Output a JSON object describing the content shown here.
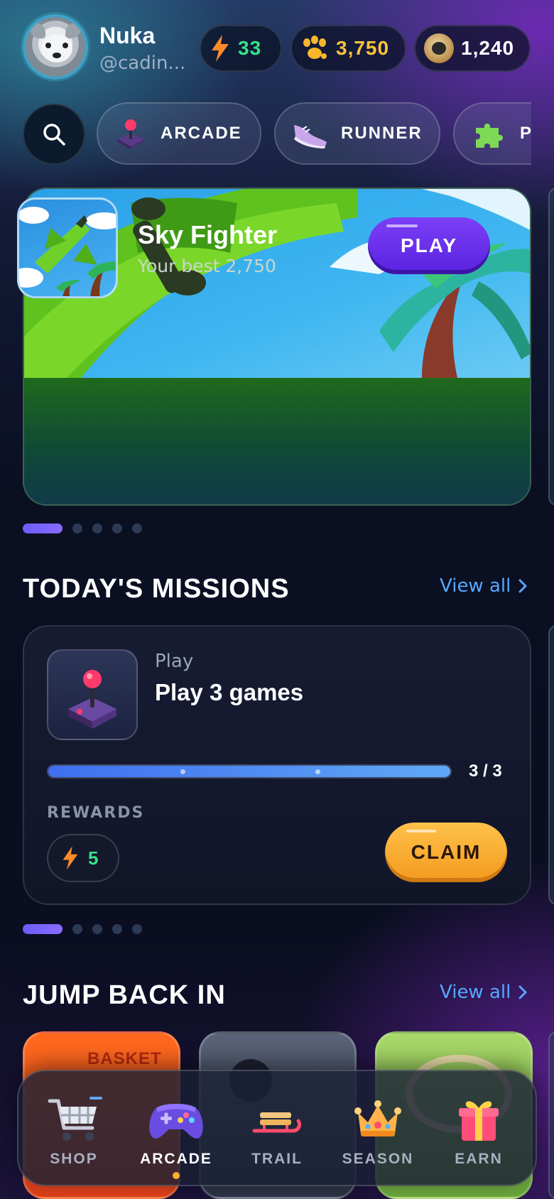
{
  "profile": {
    "name": "Nuka",
    "handle": "@cadin..."
  },
  "currencies": {
    "energy": {
      "icon": "lightning-icon",
      "value": "33",
      "color": "#35e28a"
    },
    "paws": {
      "icon": "paw-icon",
      "value": "3,750",
      "color": "#f8c33a"
    },
    "tokens": {
      "icon": "raccoon-coin-icon",
      "value": "1,240",
      "color": "#ffffff"
    }
  },
  "categories": {
    "search_icon": "search-icon",
    "items": [
      {
        "label": "ARCADE",
        "icon": "joystick-icon"
      },
      {
        "label": "RUNNER",
        "icon": "sneaker-icon"
      },
      {
        "label": "PU",
        "icon": "puzzle-icon"
      }
    ]
  },
  "featured": {
    "title": "Sky Fighter",
    "subtitle": "Your best 2,750",
    "play_label": "PLAY",
    "carousel": {
      "count": 5,
      "active": 0
    }
  },
  "missions": {
    "title": "TODAY'S MISSIONS",
    "view_all": "View all",
    "card": {
      "category": "Play",
      "name": "Play 3 games",
      "icon": "joystick-icon",
      "progress": {
        "current": 3,
        "total": 3,
        "text": "3 / 3",
        "fraction": 1.0
      },
      "rewards_label": "REWARDS",
      "reward_value": "5",
      "reward_icon": "lightning-icon",
      "claim_label": "CLAIM"
    },
    "carousel": {
      "count": 5,
      "active": 0
    }
  },
  "jump_back": {
    "title": "JUMP BACK IN",
    "view_all": "View all",
    "cards": [
      {
        "name": "basket",
        "label": "BASKET"
      },
      {
        "name": "dark-game",
        "label": ""
      },
      {
        "name": "green-game",
        "label": ""
      }
    ]
  },
  "nav": {
    "items": [
      {
        "label": "SHOP",
        "icon": "cart-icon",
        "active": false
      },
      {
        "label": "ARCADE",
        "icon": "gamepad-icon",
        "active": true
      },
      {
        "label": "TRAIL",
        "icon": "sled-icon",
        "active": false
      },
      {
        "label": "SEASON",
        "icon": "crown-icon",
        "active": false
      },
      {
        "label": "EARN",
        "icon": "gift-icon",
        "active": false
      }
    ],
    "accent": "#ffb02e"
  },
  "colors": {
    "primary": "#5a22e0",
    "claim": "#f39a1e",
    "link": "#55a8ff"
  }
}
